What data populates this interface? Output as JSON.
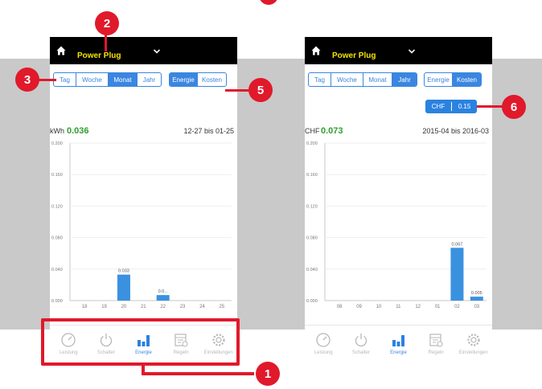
{
  "device": {
    "name": "Power Plug"
  },
  "period_tabs": [
    "Tag",
    "Woche",
    "Monat",
    "Jahr"
  ],
  "mode_tabs": [
    "Energie",
    "Kosten"
  ],
  "tariff": {
    "currency": "CHF",
    "rate": "0.15"
  },
  "left_screen": {
    "active_period": "Monat",
    "active_mode": "Energie",
    "unit": "kWh",
    "total": "0.036",
    "range": "12-27 bis 01-25"
  },
  "right_screen": {
    "active_period": "Jahr",
    "active_mode": "Kosten",
    "unit": "CHF",
    "total": "0.073",
    "range": "2015-04 bis 2016-03"
  },
  "tabbar": [
    {
      "label": "Leistung",
      "icon": "gauge-icon"
    },
    {
      "label": "Schalter",
      "icon": "power-icon"
    },
    {
      "label": "Energie",
      "icon": "bar-chart-icon"
    },
    {
      "label": "Regeln",
      "icon": "calendar-icon"
    },
    {
      "label": "Einstellungen",
      "icon": "gear-icon"
    }
  ],
  "callouts": [
    "1",
    "2",
    "3",
    "5",
    "6"
  ],
  "colors": {
    "accent": "#3a86e0",
    "bar": "#3a91e0",
    "highlight": "#e0192b",
    "value_green": "#2fa02f",
    "title_yellow": "#f5e400"
  },
  "chart_data": [
    {
      "type": "bar",
      "categories": [
        "18",
        "19",
        "20",
        "21",
        "22",
        "23",
        "24",
        "25"
      ],
      "values": [
        0,
        0,
        0.033,
        0,
        0.007,
        0,
        0,
        0
      ],
      "data_labels": [
        "",
        "",
        "0.033",
        "",
        "0.0...",
        "",
        "",
        ""
      ],
      "yticks": [
        "0.000",
        "0.040",
        "0.080",
        "0.120",
        "0.160",
        "0.200"
      ],
      "ylim": [
        0,
        0.2
      ],
      "grid": true
    },
    {
      "type": "bar",
      "categories": [
        "08",
        "09",
        "10",
        "11",
        "12",
        "01",
        "02",
        "03"
      ],
      "values": [
        0,
        0,
        0,
        0,
        0,
        0,
        0.067,
        0.005
      ],
      "data_labels": [
        "",
        "",
        "",
        "",
        "",
        "",
        "0.067",
        "0.005"
      ],
      "yticks": [
        "0.000",
        "0.040",
        "0.080",
        "0.120",
        "0.160",
        "0.200"
      ],
      "ylim": [
        0,
        0.2
      ],
      "grid": true
    }
  ]
}
